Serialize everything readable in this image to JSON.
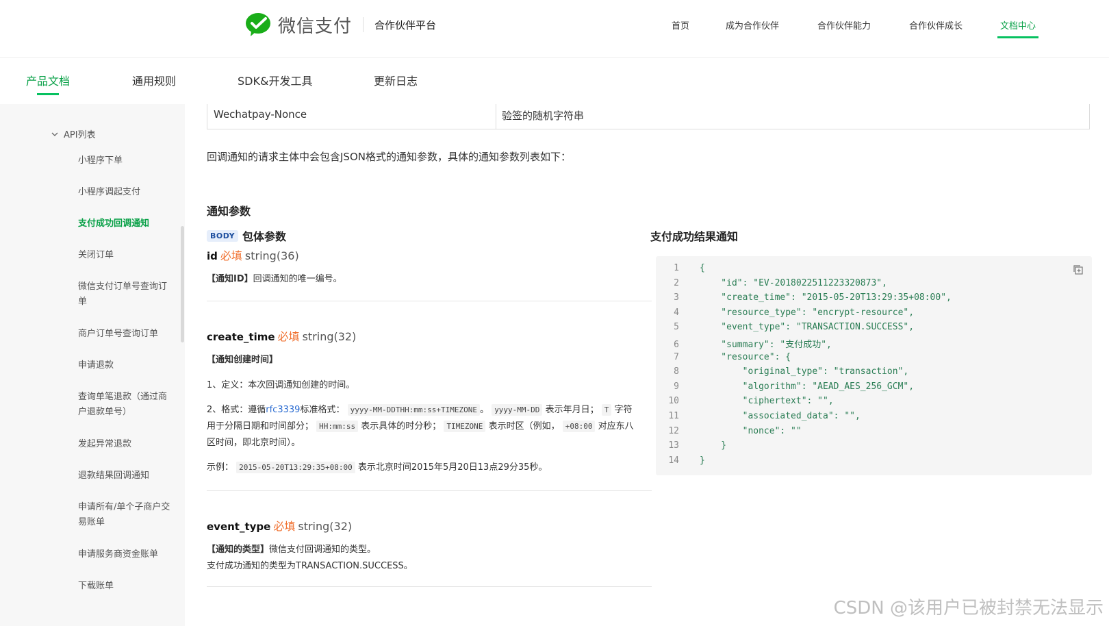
{
  "brand": {
    "logo_text": "微信支付",
    "platform": "合作伙伴平台",
    "accent_color": "#07c160"
  },
  "top_nav": [
    {
      "label": "首页",
      "active": false
    },
    {
      "label": "成为合作伙伴",
      "active": false
    },
    {
      "label": "合作伙伴能力",
      "active": false
    },
    {
      "label": "合作伙伴成长",
      "active": false
    },
    {
      "label": "文档中心",
      "active": true
    }
  ],
  "sub_nav": [
    {
      "label": "产品文档",
      "active": true
    },
    {
      "label": "通用规则",
      "active": false
    },
    {
      "label": "SDK&开发工具",
      "active": false
    },
    {
      "label": "更新日志",
      "active": false
    }
  ],
  "sidebar": {
    "group_label": "API列表",
    "items": [
      {
        "label": "小程序下单",
        "active": false
      },
      {
        "label": "小程序调起支付",
        "active": false
      },
      {
        "label": "支付成功回调通知",
        "active": true
      },
      {
        "label": "关闭订单",
        "active": false
      },
      {
        "label": "微信支付订单号查询订单",
        "active": false
      },
      {
        "label": "商户订单号查询订单",
        "active": false
      },
      {
        "label": "申请退款",
        "active": false
      },
      {
        "label": "查询单笔退款（通过商户退款单号）",
        "active": false
      },
      {
        "label": "发起异常退款",
        "active": false
      },
      {
        "label": "退款结果回调通知",
        "active": false
      },
      {
        "label": "申请所有/单个子商户交易账单",
        "active": false
      },
      {
        "label": "申请服务商资金账单",
        "active": false
      },
      {
        "label": "下载账单",
        "active": false
      }
    ]
  },
  "header_table_row": {
    "name": "Wechatpay-Nonce",
    "desc": "验签的随机字符串"
  },
  "intro_text": "回调通知的请求主体中会包含JSON格式的通知参数，具体的通知参数列表如下：",
  "section_title": "通知参数",
  "body_badge": "BODY",
  "body_title": "包体参数",
  "right_title": "支付成功结果通知",
  "params": {
    "id": {
      "name": "id",
      "required": "必填",
      "type": "string(36)",
      "desc_bold": "【通知ID】",
      "desc": "回调通知的唯一编号。"
    },
    "create_time": {
      "name": "create_time",
      "required": "必填",
      "type": "string(32)",
      "desc_bold": "【通知创建时间】",
      "line1": "1、定义：本次回调通知创建的时间。",
      "line2_a": "2、格式：遵循",
      "line2_link": "rfc3339",
      "line2_b": "标准格式：",
      "code_fmt": "yyyy-MM-DDTHH:mm:ss+TIMEZONE",
      "line2_c": "。",
      "code_date": "yyyy-MM-DD",
      "line2_d": "表示年月日；",
      "code_t": "T",
      "line2_e": "字符用于分隔日期和时间部分；",
      "code_hms": "HH:mm:ss",
      "line2_f": "表示具体的时分秒；",
      "code_tz": "TIMEZONE",
      "line2_g": "表示时区（例如，",
      "code_offset": "+08:00",
      "line2_h": "对应东八区时间，即北京时间）。",
      "example_label": "示例：",
      "example_code": "2015-05-20T13:29:35+08:00",
      "example_text": "表示北京时间2015年5月20日13点29分35秒。"
    },
    "event_type": {
      "name": "event_type",
      "required": "必填",
      "type": "string(32)",
      "desc_bold": "【通知的类型】",
      "desc": "微信支付回调通知的类型。",
      "desc2": "支付成功通知的类型为TRANSACTION.SUCCESS。"
    }
  },
  "code_lines": [
    {
      "n": "1",
      "text": "{"
    },
    {
      "n": "2",
      "text": "    \"id\": \"EV-2018022511223320873\","
    },
    {
      "n": "3",
      "text": "    \"create_time\": \"2015-05-20T13:29:35+08:00\","
    },
    {
      "n": "4",
      "text": "    \"resource_type\": \"encrypt-resource\","
    },
    {
      "n": "5",
      "text": "    \"event_type\": \"TRANSACTION.SUCCESS\","
    },
    {
      "n": "6",
      "text": "    \"summary\": \"支付成功\","
    },
    {
      "n": "7",
      "text": "    \"resource\": {"
    },
    {
      "n": "8",
      "text": "        \"original_type\": \"transaction\","
    },
    {
      "n": "9",
      "text": "        \"algorithm\": \"AEAD_AES_256_GCM\","
    },
    {
      "n": "10",
      "text": "        \"ciphertext\": \"\","
    },
    {
      "n": "11",
      "text": "        \"associated_data\": \"\","
    },
    {
      "n": "12",
      "text": "        \"nonce\": \"\""
    },
    {
      "n": "13",
      "text": "    }"
    },
    {
      "n": "14",
      "text": "}"
    }
  ],
  "watermark": "CSDN @该用户已被封禁无法显示"
}
